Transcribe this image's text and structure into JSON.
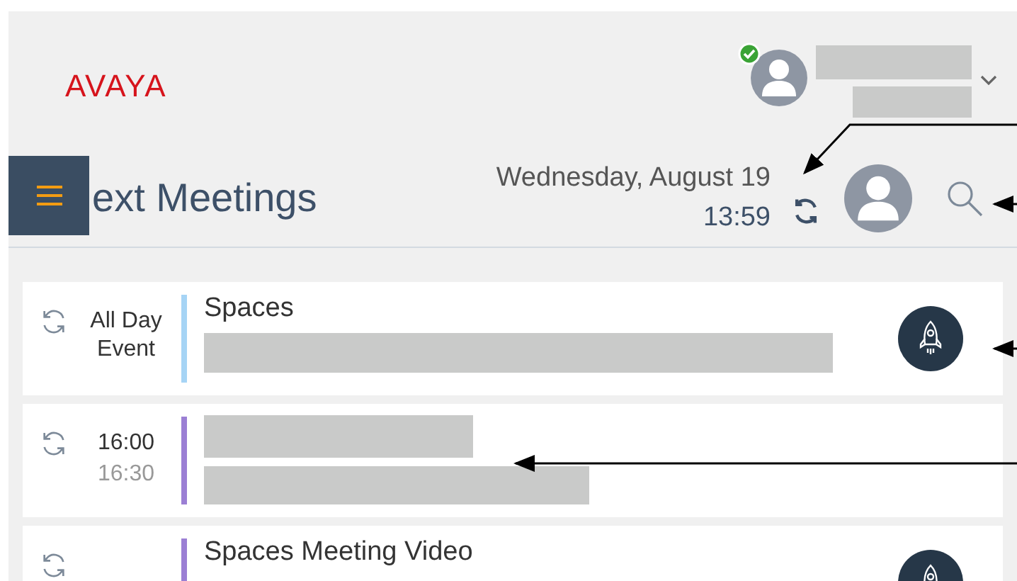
{
  "header": {
    "logo": "AVAYA",
    "online": true
  },
  "toolbar": {
    "title": "ext Meetings",
    "date": "Wednesday, August 19",
    "time": "13:59"
  },
  "meetings": [
    {
      "kind": "titled",
      "recurring": true,
      "start": "All Day Event",
      "color": "#a6d4f5",
      "title": "Spaces",
      "space_link": true
    },
    {
      "kind": "redacted",
      "recurring": true,
      "start": "16:00",
      "end": "16:30",
      "color": "#9b7fd4",
      "space_link": false
    },
    {
      "kind": "titled",
      "recurring": true,
      "color": "#9b7fd4",
      "title": "Spaces Meeting Video",
      "space_link": true
    }
  ]
}
